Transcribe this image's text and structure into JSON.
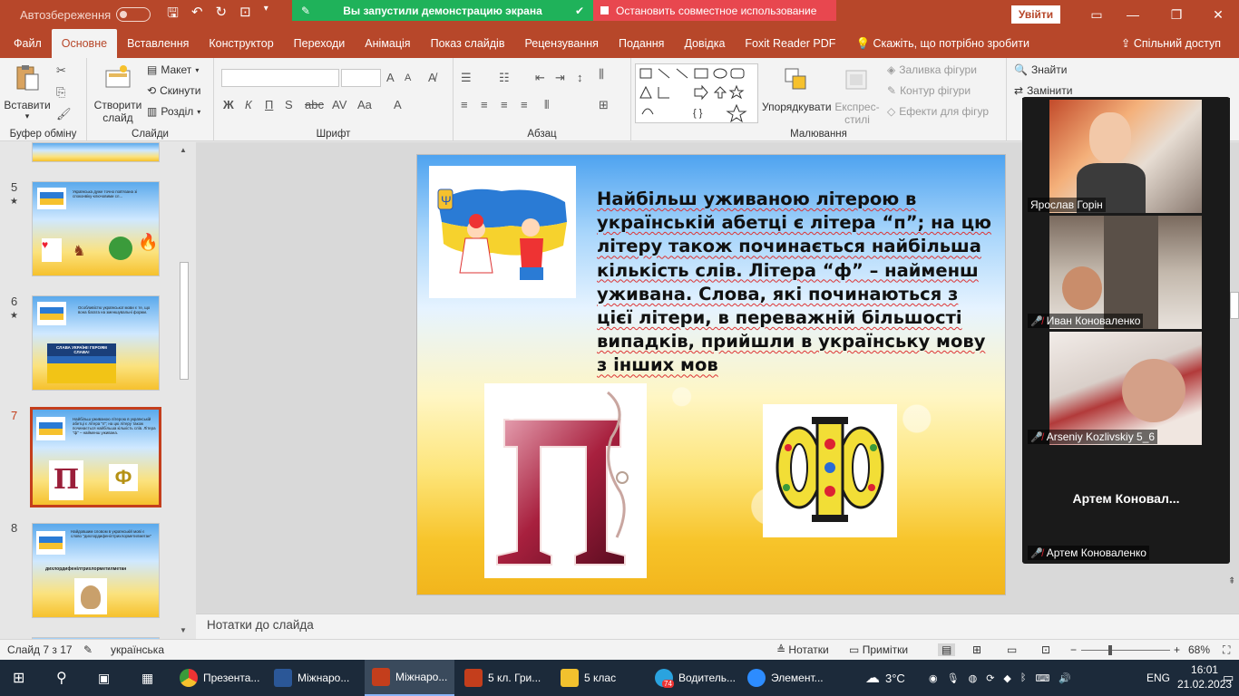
{
  "titlebar": {
    "autosave_label": "Автозбереження",
    "share_running": "Вы запустили демонстрацию экрана",
    "share_stop": "Остановить совместное использование",
    "signin": "Увійти"
  },
  "menu": [
    "Файл",
    "Основне",
    "Вставлення",
    "Конструктор",
    "Переходи",
    "Анімація",
    "Показ слайдів",
    "Рецензування",
    "Подання",
    "Довідка",
    "Foxit Reader PDF",
    "Скажіть, що потрібно зробити",
    "Спільний доступ"
  ],
  "ribbon": {
    "paste": "Вставити",
    "clipboard": "Буфер обміну",
    "new_slide_1": "Створити",
    "new_slide_2": "слайд",
    "layout": "Макет",
    "reset": "Скинути",
    "section": "Розділ",
    "slides": "Слайди",
    "font_group": "Шрифт",
    "bold": "Ж",
    "italic": "К",
    "underline": "П",
    "paragraph": "Абзац",
    "arrange": "Упорядкувати",
    "quick_styles_1": "Експрес-",
    "quick_styles_2": "стилі",
    "shape_fill": "Заливка фігури",
    "shape_outline": "Контур фігури",
    "shape_effects": "Ефекти для фігур",
    "drawing": "Малювання",
    "find": "Знайти",
    "replace": "Замінити"
  },
  "thumbnails": [
    {
      "num": "5",
      "star": "★",
      "text": "Українська дуже точно пов'язана зі споконвіку-ключовими сл... ",
      "current": false
    },
    {
      "num": "6",
      "star": "★",
      "text": "Особливістю української мови є те, що вона багата на зменшувальні форми.",
      "banner": "СЛАВА УКРАЇНІ! ГЕРОЯМ СЛАВА!",
      "current": false
    },
    {
      "num": "7",
      "star": "",
      "text": "Найбільш уживаною літерою в українській абетці є літера \"п\"; на цю літеру також починається найбільша кількість слів. Літера \"ф\" – найменш уживана.",
      "current": true
    },
    {
      "num": "8",
      "star": "",
      "text": "Найдовшим словом в українській мові є слово \"дихлордифенілтрихлорметилметан\"",
      "word": "дихлордифенілтрихлорметилметан",
      "current": false
    }
  ],
  "slide": {
    "text": "Найбільш уживаною літерою в українській абетці є літера “п”; на цю літеру також починається найбільша кількість слів. Літера “ф” – найменш уживана. Слова, які починаються з цієї літери, в переважній більшості випадків, прийшли в українську мову з інших мов",
    "letter_p": "П",
    "letter_f": "Ф"
  },
  "notes_placeholder": "Нотатки до слайда",
  "status": {
    "slide_counter": "Слайд 7 з 17",
    "language": "українська",
    "notes": "Нотатки",
    "comments": "Примітки",
    "zoom": "68%",
    "zoom_level": 0.68
  },
  "participants": [
    {
      "name": "Ярослав Горін",
      "muted": false
    },
    {
      "name": "Иван Коноваленко",
      "muted": true
    },
    {
      "name": "Arseniy Kozlivskiy 5_6",
      "muted": true
    },
    {
      "name": "Артем Коноваленко",
      "muted": true,
      "placeholder": "Артем  Коновал..."
    }
  ],
  "taskbar": {
    "items": [
      "Презента...",
      "Міжнаро...",
      "Міжнаро...",
      "5 кл. Гри...",
      "5 клас",
      "Водитель...",
      "Элемент..."
    ],
    "telegram_badge": "74",
    "weather": "3°C",
    "lang": "ENG",
    "time": "16:01",
    "date": "21.02.2023"
  },
  "colors": {
    "accent": "#b7472a",
    "selected": "#c43e1c",
    "share_green": "#1fb25a",
    "share_red": "#e8474f"
  }
}
